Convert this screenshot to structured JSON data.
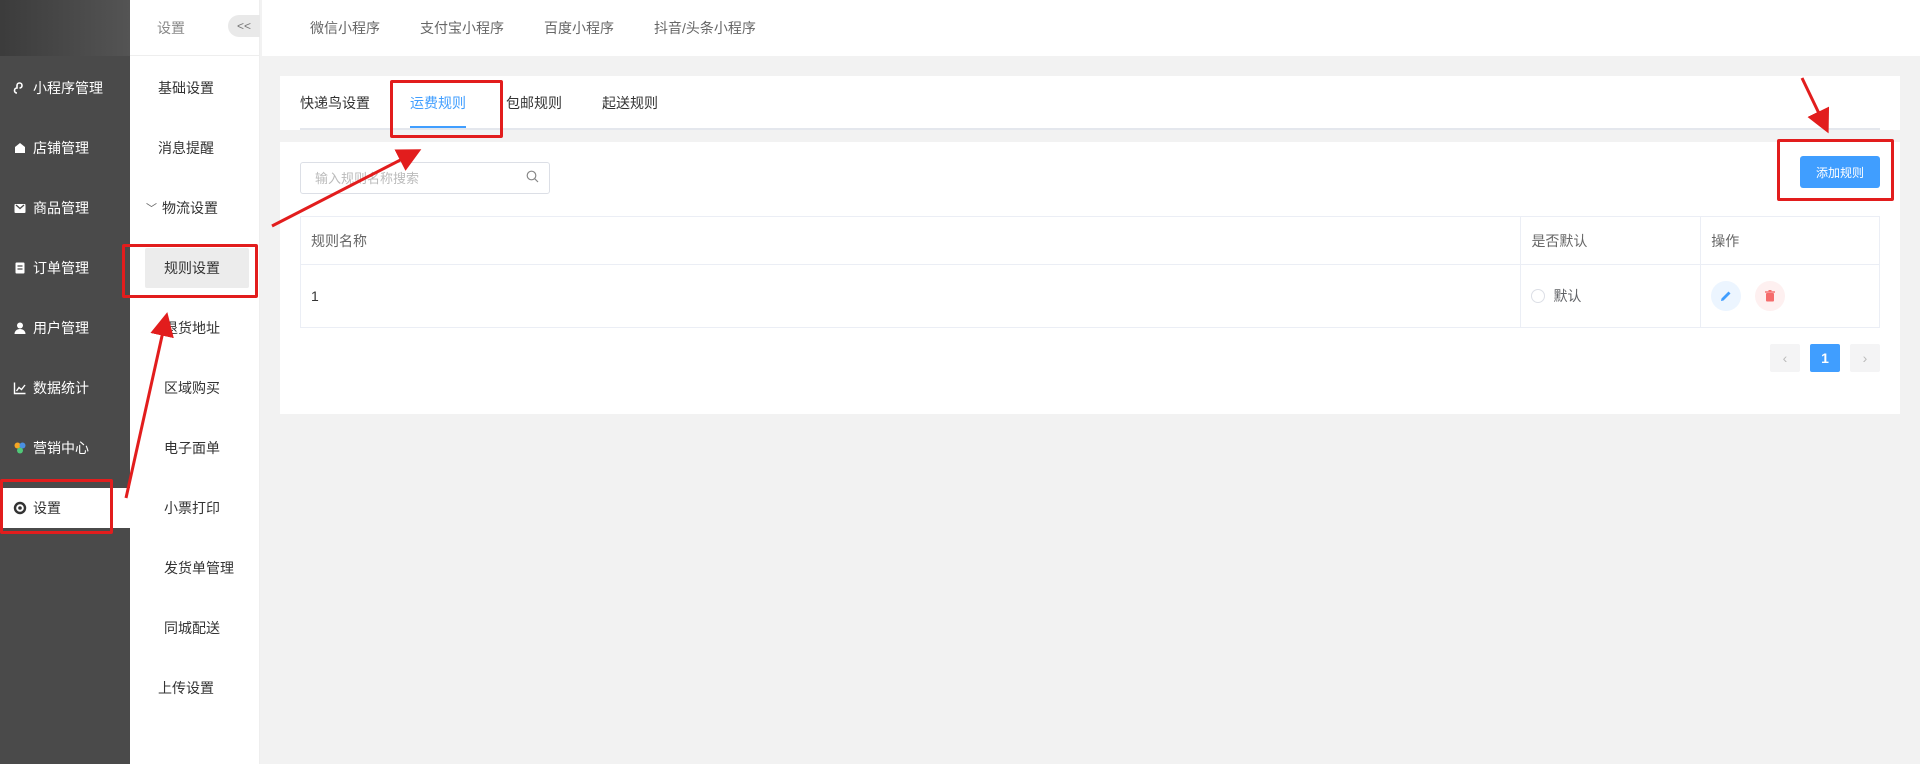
{
  "sidebar": {
    "items": [
      {
        "icon": "mini-program-icon",
        "label": "小程序管理"
      },
      {
        "icon": "store-icon",
        "label": "店铺管理"
      },
      {
        "icon": "goods-icon",
        "label": "商品管理"
      },
      {
        "icon": "order-icon",
        "label": "订单管理"
      },
      {
        "icon": "user-icon",
        "label": "用户管理"
      },
      {
        "icon": "chart-icon",
        "label": "数据统计"
      },
      {
        "icon": "marketing-icon",
        "label": "营销中心"
      },
      {
        "icon": "gear-icon",
        "label": "设置"
      }
    ]
  },
  "submenu": {
    "title": "设置",
    "collapse": "<<",
    "items": [
      "基础设置",
      "消息提醒",
      "物流设置",
      "规则设置",
      "退货地址",
      "区域购买",
      "电子面单",
      "小票打印",
      "发货单管理",
      "同城配送",
      "上传设置"
    ]
  },
  "topbar": {
    "tabs": [
      "微信小程序",
      "支付宝小程序",
      "百度小程序",
      "抖音/头条小程序"
    ]
  },
  "content": {
    "tabs": [
      "快递鸟设置",
      "运费规则",
      "包邮规则",
      "起送规则"
    ],
    "active_tab": "运费规则",
    "search_placeholder": "输入规则名称搜索",
    "add_button": "添加规则",
    "table": {
      "headers": [
        "规则名称",
        "是否默认",
        "操作"
      ],
      "rows": [
        {
          "name": "1",
          "default_label": "默认"
        }
      ]
    },
    "pagination": {
      "prev": "‹",
      "current": "1",
      "next": "›"
    }
  },
  "colors": {
    "sidebar_bg": "#4a4a4a",
    "accent": "#409eff",
    "annotation": "#e21d1d"
  }
}
